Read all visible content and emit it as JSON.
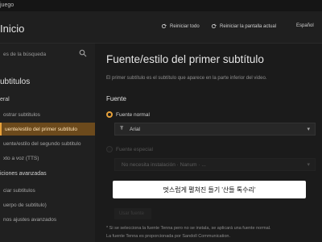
{
  "titlebar": {
    "title": "juego"
  },
  "topbar": {
    "home": "Inicio",
    "reset_all": "Reiniciar todo",
    "reset_screen": "Reiniciar la pantalla actual",
    "language": "Español"
  },
  "sidebar": {
    "search_placeholder": "es de la búsqueda",
    "section_title": "ubtitulos",
    "general_title": "eral",
    "items": [
      "ostrar subtitulos",
      "uente/estilo del primer subtitulo",
      "uente/estilo del segundo subtitulo",
      "xto a voz (TTS)"
    ],
    "advanced_title": "iciones avanzadas",
    "advanced_items": [
      "ciar subtitulos",
      "uerpo de subtitulo)",
      "nos ajustes avanzados"
    ]
  },
  "main": {
    "heading": "Fuente/estilo del primer subtítulo",
    "description": "El primer subtítulo es el subtítulo que aparece en la parte inferior del video.",
    "fuente_label": "Fuente",
    "option_normal": "Fuente normal",
    "font_value": "Arial",
    "option_special": "Fuente especial",
    "special_placeholder": "No necesita instalación · Nanum · ...",
    "button_faint": "Usar fuente",
    "note_1": "* Si se selecciona la fuente Tenna pero no se instala, se aplicará una fuente normal.",
    "note_2": "La fuente Tenna es proporcionada por Sandoll Communication."
  },
  "toast": {
    "text": "멋스럽게 펼쳐진 들기 '산들 톡수리'"
  }
}
